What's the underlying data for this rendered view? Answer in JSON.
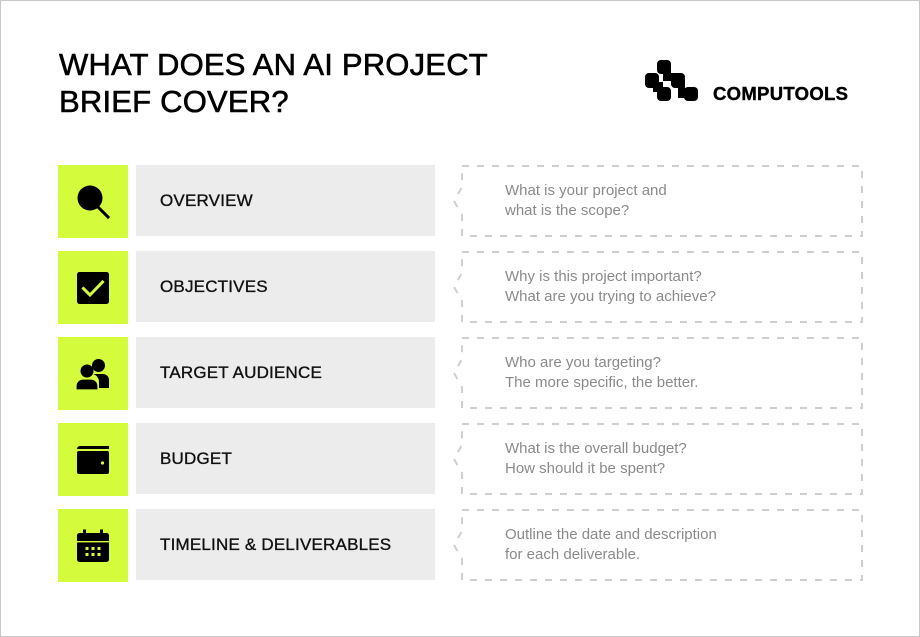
{
  "title_lines": [
    "WHAT DOES AN AI PROJECT",
    "BRIEF COVER?"
  ],
  "logo": {
    "text": "COMPUTOOLS",
    "icon": "computools-logo-mark"
  },
  "colors": {
    "accent": "#d4fc3c",
    "label_bg": "#ececec",
    "dash": "#cfcfcf",
    "desc_text": "#8a8a8a"
  },
  "items": [
    {
      "icon": "search-icon",
      "label": "OVERVIEW",
      "desc": [
        "What is your project and",
        "what is the scope?"
      ]
    },
    {
      "icon": "checkbox-icon",
      "label": "OBJECTIVES",
      "desc": [
        "Why is this project important?",
        "What are you trying to achieve?"
      ]
    },
    {
      "icon": "people-icon",
      "label": "TARGET AUDIENCE",
      "desc": [
        "Who are you targeting?",
        "The more specific, the better."
      ]
    },
    {
      "icon": "wallet-icon",
      "label": "BUDGET",
      "desc": [
        "What is the overall budget?",
        "How should it be spent?"
      ]
    },
    {
      "icon": "calendar-icon",
      "label": "TIMELINE & DELIVERABLES",
      "desc": [
        "Outline the date and description",
        "for each deliverable."
      ]
    }
  ]
}
